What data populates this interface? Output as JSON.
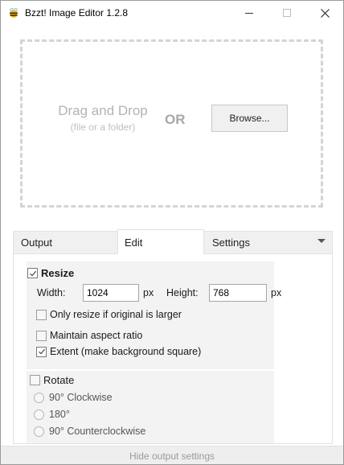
{
  "window": {
    "title": "Bzzt! Image Editor 1.2.8",
    "icon": "bee-icon",
    "controls": [
      "minimize-icon",
      "maximize-icon",
      "close-icon"
    ]
  },
  "dropzone": {
    "title": "Drag and Drop",
    "subtitle": "(file or a folder)",
    "or_label": "OR",
    "browse_label": "Browse..."
  },
  "tabs": [
    {
      "label": "Output",
      "active": false
    },
    {
      "label": "Edit",
      "active": true
    },
    {
      "label": "Settings",
      "active": false
    }
  ],
  "edit": {
    "resize": {
      "label": "Resize",
      "checked": true,
      "width_label": "Width:",
      "width_value": "1024",
      "width_unit": "px",
      "height_label": "Height:",
      "height_value": "768",
      "height_unit": "px",
      "options": [
        {
          "label": "Only resize if original is larger",
          "checked": false
        },
        {
          "label": "Maintain aspect ratio",
          "checked": false
        },
        {
          "label": "Extent (make background square)",
          "checked": true
        }
      ]
    },
    "rotate": {
      "label": "Rotate",
      "checked": false,
      "options": [
        {
          "label": "90° Clockwise",
          "selected": false
        },
        {
          "label": "180°",
          "selected": false
        },
        {
          "label": "90° Counterclockwise",
          "selected": false
        }
      ]
    }
  },
  "footer": {
    "toggle_label": "Hide output settings"
  },
  "colors": {
    "border": "#9a9a9a",
    "dash": "#d4d4d4",
    "group_bg": "#f3f3f3",
    "footer_bg": "#eeeeee",
    "check": "#555555"
  }
}
